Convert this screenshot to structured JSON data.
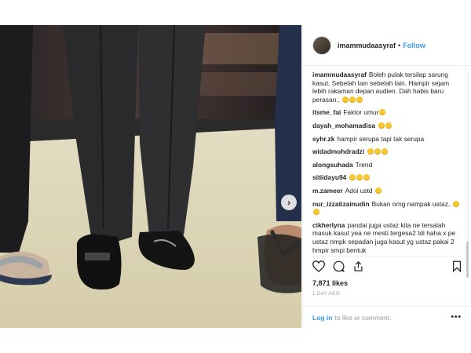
{
  "post": {
    "username": "imammudaasyraf",
    "separator": "•",
    "follow_label": "Follow",
    "caption": {
      "username": "imammudaasyraf",
      "text": "Boleh pulak tersilap sarung kasut. Sebelah lain sebelah lain. Hampir sejam lebih rakaman depan audien. Dah habis baru perasan..",
      "emoji": [
        "laughing",
        "laughing",
        "laughing"
      ]
    },
    "comments": [
      {
        "username": "itsme_fai",
        "text": "Faktor umur",
        "emoji": [
          "laughing"
        ]
      },
      {
        "username": "dayah_mohamadisa",
        "text": "",
        "emoji": [
          "laughing",
          "laughing"
        ]
      },
      {
        "username": "syhr.zk",
        "text": "hampir serupa tapi tak serupa",
        "emoji": []
      },
      {
        "username": "widadmohdradzi",
        "text": "",
        "emoji": [
          "laughing",
          "laughing",
          "laughing"
        ]
      },
      {
        "username": "alongsuhada",
        "text": "Trend",
        "emoji": []
      },
      {
        "username": "sitiidayu94",
        "text": "",
        "emoji": [
          "laughing",
          "laughing",
          "laughing"
        ]
      },
      {
        "username": "m.zameer",
        "text": "Adoi ustd",
        "emoji": [
          "laughing"
        ]
      },
      {
        "username": "nur_izzatizainudin",
        "text": "Bukan orng nampak ustaz..",
        "emoji": [
          "laughing",
          "laughing"
        ]
      },
      {
        "username": "cikherlyna",
        "text": "pandai juga ustaz kita ne tersalah masuk kasut yea ne mesti tergesa2 tdi haha x pe ustaz nmpk sepadan juga kasut yg ustaz pakai 2 hmpir smpi bentuk",
        "emoji": []
      }
    ],
    "likes": "7,871 likes",
    "time_ago": "1 DAY AGO",
    "login_label": "Log in",
    "login_suffix": "to like or comment.",
    "more_label": "•••"
  },
  "carousel": {
    "count": 3,
    "active_index": 0,
    "next_glyph": "›"
  },
  "icons": {
    "like": "heart-icon",
    "comment": "comment-icon",
    "share": "share-icon",
    "save": "bookmark-icon",
    "next": "chevron-right-icon"
  },
  "colors": {
    "accent": "#3897f0",
    "text": "#262626",
    "muted": "#999999",
    "border": "#efefef"
  }
}
